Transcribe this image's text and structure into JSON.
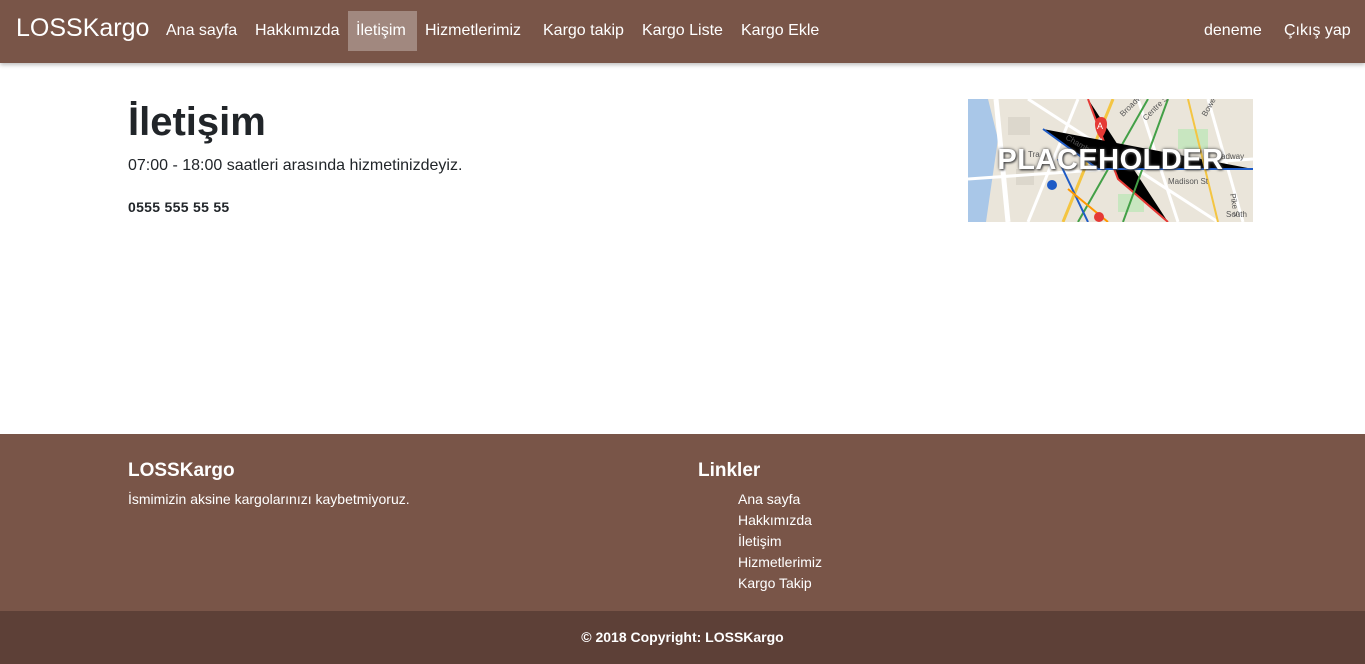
{
  "navbar": {
    "brand": "LOSSKargo",
    "items": [
      {
        "label": "Ana sayfa",
        "active": false
      },
      {
        "label": "Hakkımızda",
        "active": false
      },
      {
        "label": "İletişim",
        "active": true
      },
      {
        "label": "Hizmetlerimiz",
        "active": false
      },
      {
        "label": "Kargo takip",
        "active": false
      },
      {
        "label": "Kargo Liste",
        "active": false
      },
      {
        "label": "Kargo Ekle",
        "active": false
      }
    ],
    "user": "deneme",
    "logout": "Çıkış yap"
  },
  "main": {
    "title": "İletişim",
    "hours": "07:00 - 18:00 saatleri arasında hizmetinizdeyiz.",
    "phone": "0555 555 55 55"
  },
  "map": {
    "overlay": "PLACEHOLDER",
    "labels": [
      "Broadway",
      "Centre St",
      "Bowe",
      "Chamb",
      "Tra",
      "adway",
      "Madison St",
      "Pike S",
      "South"
    ],
    "marker_letter": "A"
  },
  "footer": {
    "brand": "LOSSKargo",
    "description": "İsmimizin aksine kargolarınızı kaybetmiyoruz.",
    "links_title": "Linkler",
    "links": [
      "Ana sayfa",
      "Hakkımızda",
      "İletişim",
      "Hizmetlerimiz",
      "Kargo Takip"
    ]
  },
  "copyright": "© 2018 Copyright: LOSSKargo",
  "colors": {
    "primary": "#795548",
    "primary_dark": "#5d4037",
    "active_nav_bg": "rgba(255,255,255,0.3)"
  }
}
